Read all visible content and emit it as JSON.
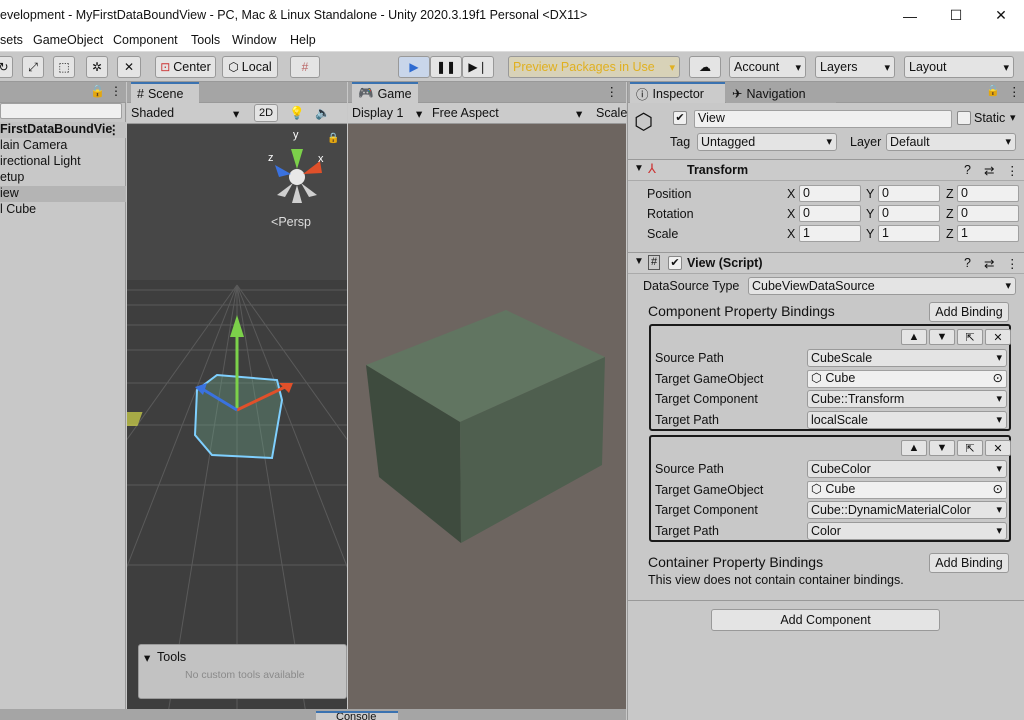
{
  "window": {
    "title": "evelopment - MyFirstDataBoundView - PC, Mac & Linux Standalone - Unity 2020.3.19f1 Personal <DX11>",
    "minimize": "—",
    "maximize": "☐",
    "close": "✕"
  },
  "menu": [
    "sets",
    "GameObject",
    "Component",
    "Tools",
    "Window",
    "Help"
  ],
  "toolbar": {
    "center": "Center",
    "local": "Local",
    "preview": "Preview Packages in Use",
    "account": "Account",
    "layers": "Layers",
    "layout": "Layout"
  },
  "hierarchy": {
    "root": "FirstDataBoundVie",
    "items": [
      "lain Camera",
      "irectional Light",
      "etup",
      "iew",
      "l Cube"
    ],
    "selected_index": 3
  },
  "scene": {
    "tab": "Scene",
    "shading": "Shaded",
    "mode2d": "2D",
    "persp": "Persp",
    "axis_x": "x",
    "axis_y": "y",
    "axis_z": "z",
    "tools_title": "Tools",
    "tools_note": "No custom tools available"
  },
  "game": {
    "tab": "Game",
    "display": "Display 1",
    "aspect": "Free Aspect",
    "scale": "Scale"
  },
  "inspector": {
    "tab": "Inspector",
    "nav_tab": "Navigation",
    "object_name": "View",
    "static_label": "Static",
    "tag_label": "Tag",
    "tag_value": "Untagged",
    "layer_label": "Layer",
    "layer_value": "Default",
    "transform": {
      "title": "Transform",
      "position_label": "Position",
      "rotation_label": "Rotation",
      "scale_label": "Scale",
      "x": "X",
      "y": "Y",
      "z": "Z",
      "position": [
        "0",
        "0",
        "0"
      ],
      "rotation": [
        "0",
        "0",
        "0"
      ],
      "scale": [
        "1",
        "1",
        "1"
      ]
    },
    "script": {
      "title": "View (Script)",
      "datasource_label": "DataSource Type",
      "datasource_value": "CubeViewDataSource",
      "component_bindings_title": "Component Property Bindings",
      "add_binding": "Add Binding",
      "bindings": [
        {
          "source_label": "Source Path",
          "source": "CubeScale",
          "target_go_label": "Target GameObject",
          "target_go": "Cube",
          "target_comp_label": "Target Component",
          "target_comp": "Cube::Transform",
          "target_path_label": "Target Path",
          "target_path": "localScale"
        },
        {
          "source_label": "Source Path",
          "source": "CubeColor",
          "target_go_label": "Target GameObject",
          "target_go": "Cube",
          "target_comp_label": "Target Component",
          "target_comp": "Cube::DynamicMaterialColor",
          "target_path_label": "Target Path",
          "target_path": "Color"
        }
      ],
      "container_bindings_title": "Container Property Bindings",
      "container_note": "This view does not contain container bindings."
    },
    "add_component": "Add Component"
  },
  "console_tab": "Console",
  "colors": {
    "accent": "#3a72b0",
    "play_active": "#2f6bd1",
    "preview_text": "#e0b020"
  }
}
